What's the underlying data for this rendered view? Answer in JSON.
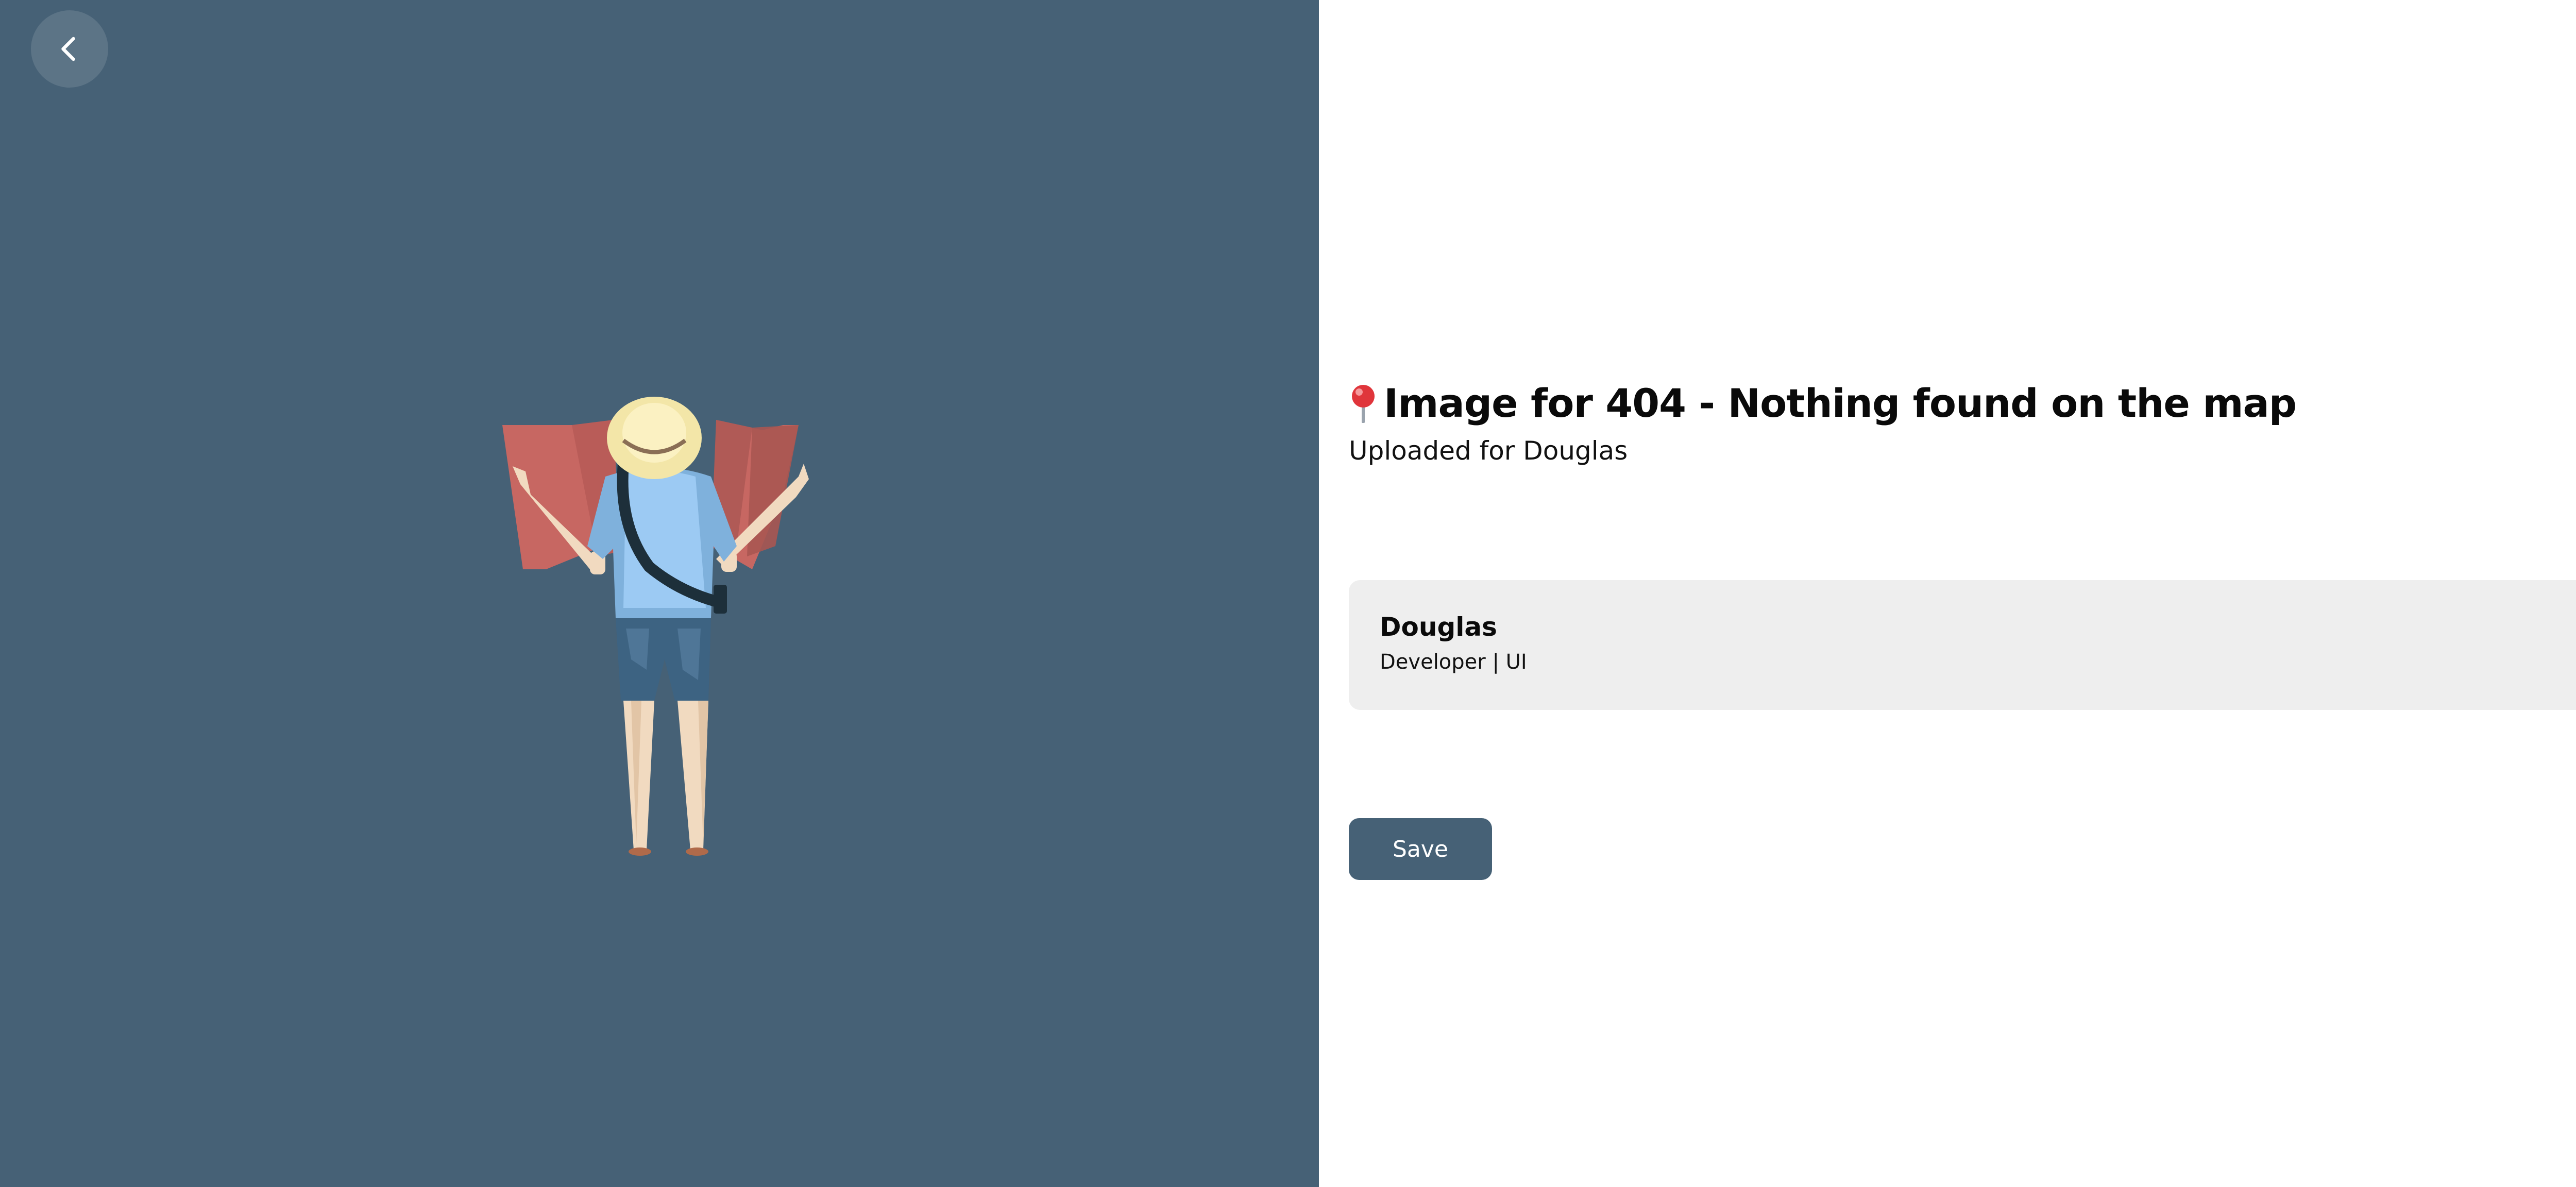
{
  "navigation": {
    "back_icon": "chevron-left-icon"
  },
  "illustration": {
    "subject": "traveler-with-map-illustration",
    "background_color": "#466176"
  },
  "header": {
    "pin_icon": "round-pushpin-icon",
    "title": "Image for 404 - Nothing found on the map",
    "subtitle": "Uploaded for Douglas"
  },
  "user_card": {
    "name": "Douglas",
    "role": "Developer | UI"
  },
  "actions": {
    "save_label": "Save"
  },
  "colors": {
    "accent": "#466176",
    "card_background": "#eeeeee",
    "text": "#0a0a0a"
  }
}
